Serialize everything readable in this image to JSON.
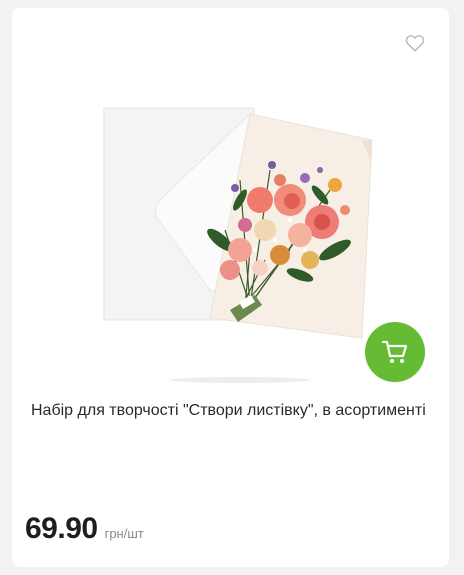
{
  "product": {
    "title": "Набір для творчості \"Створи листівку\", в асортименті",
    "price": "69.90",
    "unit": "грн/шт"
  },
  "icons": {
    "favorite": "heart-outline-icon",
    "cart": "shopping-cart-icon"
  },
  "colors": {
    "accent": "#66bb34",
    "card_background": "#ffffff",
    "page_background": "#f2f2f2"
  }
}
